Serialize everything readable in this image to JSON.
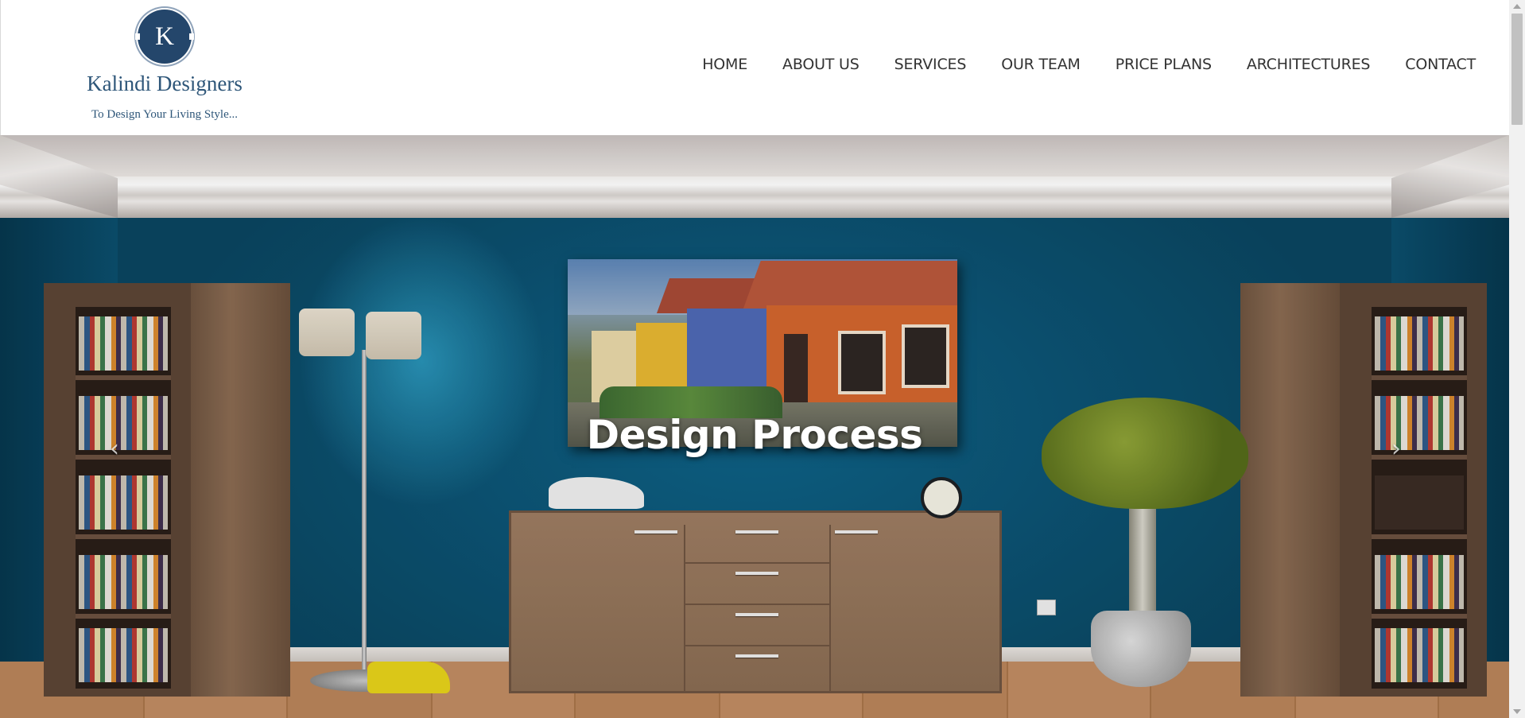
{
  "brand": {
    "logo_letter": "K",
    "name": "Kalindi Designers",
    "tagline": "To Design Your Living Style...",
    "primary_color": "#24466b"
  },
  "nav": {
    "items": [
      {
        "label": "HOME"
      },
      {
        "label": "ABOUT US"
      },
      {
        "label": "SERVICES"
      },
      {
        "label": "OUR TEAM"
      },
      {
        "label": "PRICE PLANS"
      },
      {
        "label": "ARCHITECTURES"
      },
      {
        "label": "CONTACT"
      }
    ]
  },
  "hero": {
    "caption": "Design Process",
    "prev_icon": "chevron-left-icon",
    "next_icon": "chevron-right-icon",
    "prev_glyph": "‹",
    "next_glyph": "›",
    "wall_color": "#0c4e70"
  }
}
